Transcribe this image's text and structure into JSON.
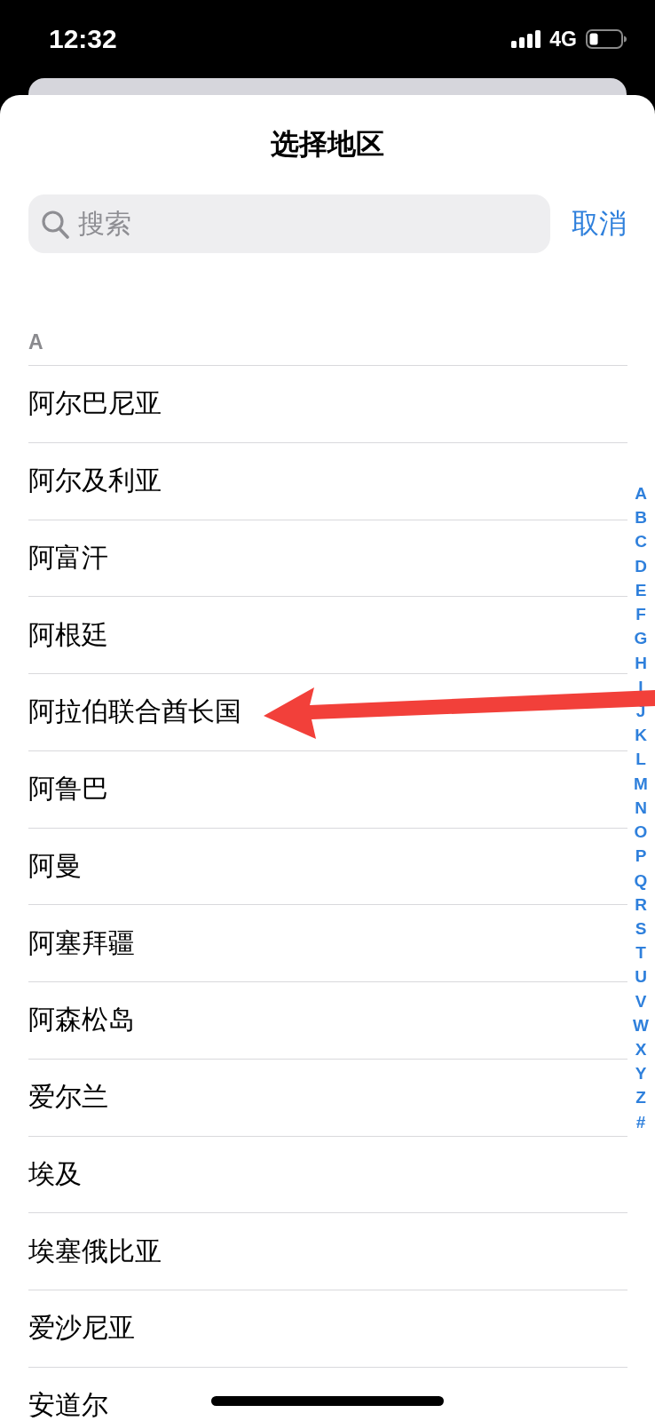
{
  "status_bar": {
    "time": "12:32",
    "network": "4G"
  },
  "sheet": {
    "title": "选择地区",
    "search": {
      "placeholder": "搜索"
    },
    "cancel_button": "取消"
  },
  "sections": [
    {
      "header": "A",
      "rows": [
        "阿尔巴尼亚",
        "阿尔及利亚",
        "阿富汗",
        "阿根廷",
        "阿拉伯联合酋长国",
        "阿鲁巴",
        "阿曼",
        "阿塞拜疆",
        "阿森松岛",
        "爱尔兰",
        "埃及",
        "埃塞俄比亚",
        "爱沙尼亚",
        "安道尔"
      ]
    }
  ],
  "index": [
    "A",
    "B",
    "C",
    "D",
    "E",
    "F",
    "G",
    "H",
    "I",
    "J",
    "K",
    "L",
    "M",
    "N",
    "O",
    "P",
    "Q",
    "R",
    "S",
    "T",
    "U",
    "V",
    "W",
    "X",
    "Y",
    "Z",
    "#"
  ]
}
